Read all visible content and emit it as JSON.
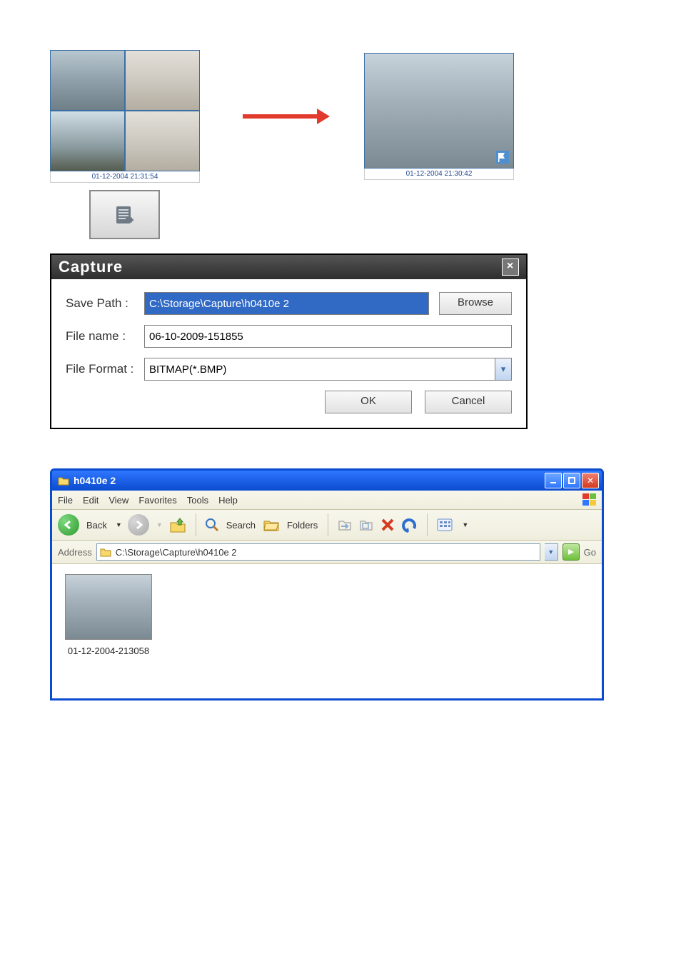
{
  "illustration": {
    "quad_timestamp": "01-12-2004 21:31:54",
    "single_timestamp": "01-12-2004 21:30:42"
  },
  "snapshot_button": {
    "icon": "snapshot-icon"
  },
  "capture_dialog": {
    "title": "Capture",
    "rows": {
      "save_path": {
        "label": "Save Path :",
        "value": "C:\\Storage\\Capture\\h0410e 2"
      },
      "file_name": {
        "label": "File name :",
        "value": "06-10-2009-151855"
      },
      "file_format": {
        "label": "File Format :",
        "value": "BITMAP(*.BMP)"
      }
    },
    "buttons": {
      "browse": "Browse",
      "ok": "OK",
      "cancel": "Cancel"
    }
  },
  "explorer": {
    "title": "h0410e 2",
    "menus": [
      "File",
      "Edit",
      "View",
      "Favorites",
      "Tools",
      "Help"
    ],
    "toolbar": {
      "back_label": "Back",
      "search_label": "Search",
      "folders_label": "Folders"
    },
    "address": {
      "label": "Address",
      "path": "C:\\Storage\\Capture\\h0410e 2",
      "go_label": "Go"
    },
    "files": [
      {
        "name": "01-12-2004-213058"
      }
    ]
  }
}
